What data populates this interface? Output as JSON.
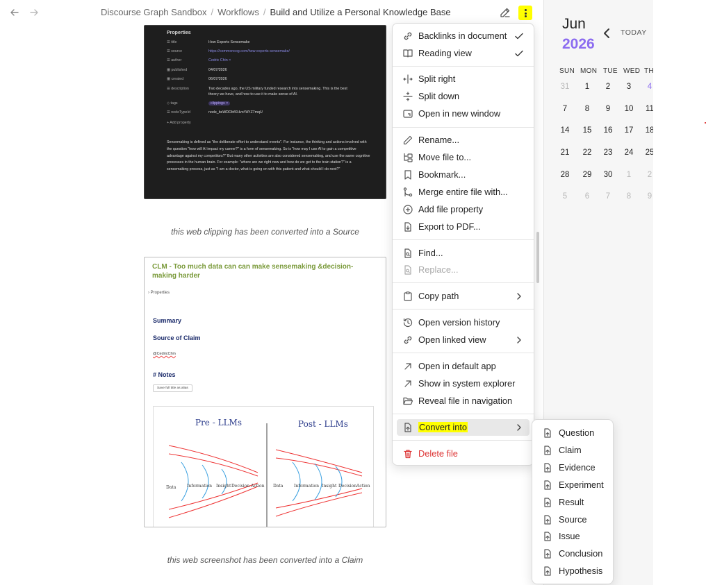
{
  "nav": {
    "back_icon": "arrow-left-icon",
    "forward_icon": "arrow-right-icon"
  },
  "breadcrumb": {
    "part1": "Discourse Graph Sandbox",
    "part2": "Workflows",
    "current": "Build and Utilize a Personal Knowledge Base",
    "separator": "/"
  },
  "document": {
    "clip1": {
      "properties_title": "Properties",
      "rows": [
        {
          "key": "title",
          "value": "How Experts Sensemake"
        },
        {
          "key": "source",
          "value": "https://commoncog.com/how-experts-sensemake/"
        },
        {
          "key": "author",
          "value": "Cedric Chin ×"
        },
        {
          "key": "published",
          "value": "04/07/2026"
        },
        {
          "key": "created",
          "value": "06/07/2026"
        },
        {
          "key": "description",
          "value": "Two decades ago, the US military funded research into sensemaking. This is the best theory we have, and how to use it to make sense of AI."
        },
        {
          "key": "tags",
          "value": "clippings ×"
        },
        {
          "key": "nodeTypeId",
          "value": "node_bsWDObfXHvoYAYZ7mqU"
        }
      ],
      "add_property": "+ Add property",
      "paragraph": "Sensemaking is defined as \"the deliberate effort to understand events\". For instance, the thinking and actions involved with the question \"how will AI impact my career?\" is a form of sensemaking. So is \"how may I use AI to gain a competitive advantage against my competitors?\" But many other activities are also considered sensemaking, and use the same cognitive processes in the human brain. For example: \"where are we right now and how do we get to the train station?\" is a sensemaking process, just as \"I am a doctor, what is going on with this patient and what should I do next?\""
    },
    "caption1": "this web clipping has been converted into a Source",
    "clip2": {
      "title": "CLM - Too much data can can make sensemaking &decision-making harder",
      "properties": "Properties",
      "summary": "Summary",
      "source_of_claim": "Source of Claim",
      "author": "@CedricChin",
      "notes": "# Notes",
      "button": "Save full title as alias",
      "fig_left": "Pre - LLMs",
      "fig_right": "Post - LLMs",
      "stages": [
        "Data",
        "Information",
        "Insight",
        "Decision",
        "Action"
      ]
    },
    "caption2": "this web screenshot has been converted into a Claim"
  },
  "calendar": {
    "month": "Jun",
    "year": "2026",
    "today": "TODAY",
    "weekdays": [
      "SUN",
      "MON",
      "TUE",
      "WED",
      "TH"
    ],
    "weeks": [
      [
        "31",
        "1",
        "2",
        "3",
        "4"
      ],
      [
        "7",
        "8",
        "9",
        "10",
        "11"
      ],
      [
        "14",
        "15",
        "16",
        "17",
        "18"
      ],
      [
        "21",
        "22",
        "23",
        "24",
        "25"
      ],
      [
        "28",
        "29",
        "30",
        "1",
        "2"
      ],
      [
        "5",
        "6",
        "7",
        "8",
        "9"
      ]
    ],
    "accent_color": "#8c6cf0"
  },
  "menu": {
    "backlinks": "Backlinks in document",
    "reading_view": "Reading view",
    "split_right": "Split right",
    "split_down": "Split down",
    "open_new_window": "Open in new window",
    "rename": "Rename...",
    "move_file": "Move file to...",
    "bookmark": "Bookmark...",
    "merge": "Merge entire file with...",
    "add_property": "Add file property",
    "export_pdf": "Export to PDF...",
    "find": "Find...",
    "replace": "Replace...",
    "copy_path": "Copy path",
    "version_history": "Open version history",
    "linked_view": "Open linked view",
    "default_app": "Open in default app",
    "system_explorer": "Show in system explorer",
    "reveal_nav": "Reveal file in navigation",
    "convert_into": "Convert into",
    "delete_file": "Delete file"
  },
  "submenu": {
    "items": [
      "Question",
      "Claim",
      "Evidence",
      "Experiment",
      "Result",
      "Source",
      "Issue",
      "Conclusion",
      "Hypothesis"
    ]
  },
  "colors": {
    "highlight": "#ffff00",
    "danger": "#d33333"
  }
}
